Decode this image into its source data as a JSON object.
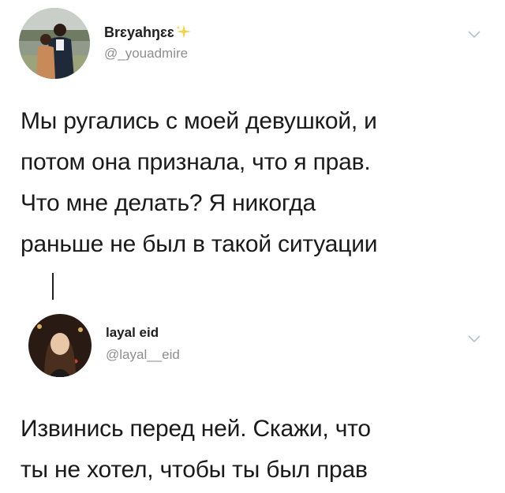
{
  "tweets": [
    {
      "display_name": "Brɛyahŋɛɛ",
      "handle": "@_youadmire",
      "avatar_icon": "user-avatar-couple-photo",
      "menu_icon": "chevron-down-icon",
      "text_lines": [
        "Мы ругались с моей девушкой, и",
        "потом она признала, что я прав.",
        "Что мне делать? Я никогда",
        "раньше не был в такой ситуации"
      ]
    },
    {
      "display_name": "layal eid",
      "handle": "@layal__eid",
      "avatar_icon": "user-avatar-woman-photo",
      "menu_icon": "chevron-down-icon",
      "text_lines": [
        "Извинись перед ней. Скажи, что",
        "ты не хотел, чтобы ты был прав"
      ]
    }
  ],
  "colors": {
    "text": "#1a1a1a",
    "handle": "#8e8e8e",
    "chevron": "#b8c0c8",
    "sparkle": "#f2d34a"
  }
}
